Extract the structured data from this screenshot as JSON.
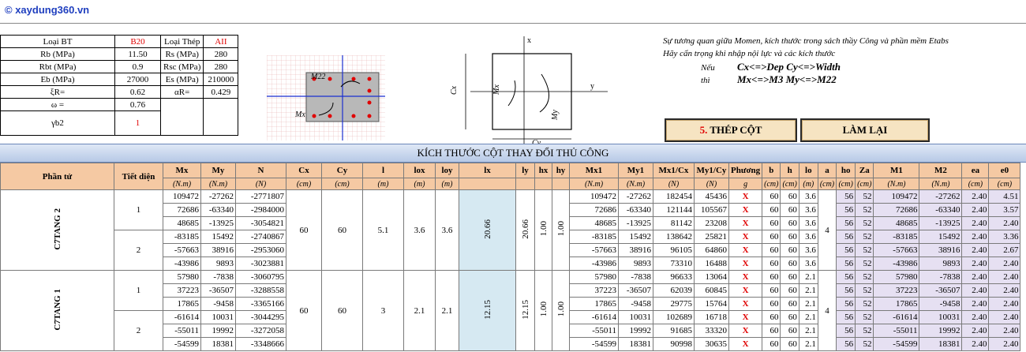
{
  "header": {
    "brand": "© xaydung360.vn"
  },
  "params": {
    "rows": [
      [
        "Loại BT",
        "B20",
        "Loại Thép",
        "AII"
      ],
      [
        "Rb (MPa)",
        "11.50",
        "Rs (MPa)",
        "280"
      ],
      [
        "Rbt (MPa)",
        "0.9",
        "Rsc (MPa)",
        "280"
      ],
      [
        "Eb (MPa)",
        "27000",
        "Es (MPa)",
        "210000"
      ],
      [
        "ξR=",
        "0.62",
        "αR=",
        "0.429"
      ],
      [
        "ω =",
        "0.76",
        "",
        ""
      ],
      [
        "γb2",
        "1",
        "",
        ""
      ]
    ]
  },
  "diagram1": {
    "mx_label": "Mx",
    "my_label": "M22"
  },
  "diagram2": {
    "cx_label": "Cx",
    "cy_label": "Cy",
    "mx_label": "Mx",
    "my_label": "My",
    "x_label": "x",
    "y_label": "y"
  },
  "notes": {
    "line1": "Sự tương quan giữa Momen, kích thước trong sách thầy Công và phần mềm Etabs",
    "line2": "Hãy cẩn trọng khi nhập nội lực và các kích thước",
    "if_label": "Nếu",
    "then_label": "thì",
    "if_text": "Cx<=>Dep Cy<=>Width",
    "then_text": "Mx<=>M3 My<=>M22"
  },
  "buttons": {
    "thep_cot_num": "5.",
    "thep_cot": " THÉP CỘT",
    "lam_lai": "LÀM LẠI"
  },
  "banner": "KÍCH THƯỚC CỘT THAY ĐỔI THỦ CÔNG",
  "table": {
    "headers": [
      "Phần tử",
      "Tiết diện",
      "Mx",
      "My",
      "N",
      "Cx",
      "Cy",
      "l",
      "lox",
      "loy",
      "lx",
      "ly",
      "hx",
      "hy",
      "Mx1",
      "My1",
      "Mx1/Cx",
      "My1/Cy",
      "Phương",
      "b",
      "h",
      "lo",
      "a",
      "ho",
      "Za",
      "M1",
      "M2",
      "ea",
      "e0"
    ],
    "units": [
      "",
      "",
      "(N.m)",
      "(N.m)",
      "(N)",
      "(cm)",
      "(cm)",
      "(m)",
      "(m)",
      "(m)",
      "",
      "",
      "",
      "",
      "(N.m)",
      "(N.m)",
      "(N)",
      "(N)",
      "g",
      "(cm)",
      "(cm)",
      "(m)",
      "(cm)",
      "(cm)",
      "(cm)",
      "(N.m)",
      "(N.m)",
      "(cm)",
      "(cm)"
    ],
    "groups": [
      {
        "name": "C7TANG 2",
        "Cx": "60",
        "Cy": "60",
        "l": "5.1",
        "lox": "3.6",
        "loy": "3.6",
        "lx": "20.66",
        "ly": "20.66",
        "hx": "1.00",
        "hy": "1.00",
        "a": "4",
        "sections": [
          {
            "id": "1",
            "rows": [
              [
                "109472",
                "-27262",
                "-2771807",
                "109472",
                "-27262",
                "182454",
                "45436",
                "X",
                "60",
                "60",
                "3.6",
                "56",
                "52",
                "109472",
                "-27262",
                "2.40",
                "4.51"
              ],
              [
                "72686",
                "-63340",
                "-2984000",
                "72686",
                "-63340",
                "121144",
                "105567",
                "X",
                "60",
                "60",
                "3.6",
                "56",
                "52",
                "72686",
                "-63340",
                "2.40",
                "3.57"
              ],
              [
                "48685",
                "-13925",
                "-3054821",
                "48685",
                "-13925",
                "81142",
                "23208",
                "X",
                "60",
                "60",
                "3.6",
                "56",
                "52",
                "48685",
                "-13925",
                "2.40",
                "2.40"
              ]
            ]
          },
          {
            "id": "2",
            "rows": [
              [
                "-83185",
                "15492",
                "-2740867",
                "-83185",
                "15492",
                "138642",
                "25821",
                "X",
                "60",
                "60",
                "3.6",
                "56",
                "52",
                "-83185",
                "15492",
                "2.40",
                "3.36"
              ],
              [
                "-57663",
                "38916",
                "-2953060",
                "-57663",
                "38916",
                "96105",
                "64860",
                "X",
                "60",
                "60",
                "3.6",
                "56",
                "52",
                "-57663",
                "38916",
                "2.40",
                "2.67"
              ],
              [
                "-43986",
                "9893",
                "-3023881",
                "-43986",
                "9893",
                "73310",
                "16488",
                "X",
                "60",
                "60",
                "3.6",
                "56",
                "52",
                "-43986",
                "9893",
                "2.40",
                "2.40"
              ]
            ]
          }
        ]
      },
      {
        "name": "C7TANG 1",
        "Cx": "60",
        "Cy": "60",
        "l": "3",
        "lox": "2.1",
        "loy": "2.1",
        "lx": "12.15",
        "ly": "12.15",
        "hx": "1.00",
        "hy": "1.00",
        "a": "4",
        "sections": [
          {
            "id": "1",
            "rows": [
              [
                "57980",
                "-7838",
                "-3060795",
                "57980",
                "-7838",
                "96633",
                "13064",
                "X",
                "60",
                "60",
                "2.1",
                "56",
                "52",
                "57980",
                "-7838",
                "2.40",
                "2.40"
              ],
              [
                "37223",
                "-36507",
                "-3288558",
                "37223",
                "-36507",
                "62039",
                "60845",
                "X",
                "60",
                "60",
                "2.1",
                "56",
                "52",
                "37223",
                "-36507",
                "2.40",
                "2.40"
              ],
              [
                "17865",
                "-9458",
                "-3365166",
                "17865",
                "-9458",
                "29775",
                "15764",
                "X",
                "60",
                "60",
                "2.1",
                "56",
                "52",
                "17865",
                "-9458",
                "2.40",
                "2.40"
              ]
            ]
          },
          {
            "id": "2",
            "rows": [
              [
                "-61614",
                "10031",
                "-3044295",
                "-61614",
                "10031",
                "102689",
                "16718",
                "X",
                "60",
                "60",
                "2.1",
                "56",
                "52",
                "-61614",
                "10031",
                "2.40",
                "2.40"
              ],
              [
                "-55011",
                "19992",
                "-3272058",
                "-55011",
                "19992",
                "91685",
                "33320",
                "X",
                "60",
                "60",
                "2.1",
                "56",
                "52",
                "-55011",
                "19992",
                "2.40",
                "2.40"
              ],
              [
                "-54599",
                "18381",
                "-3348666",
                "-54599",
                "18381",
                "90998",
                "30635",
                "X",
                "60",
                "60",
                "2.1",
                "56",
                "52",
                "-54599",
                "18381",
                "2.40",
                "2.40"
              ]
            ]
          }
        ]
      }
    ]
  }
}
